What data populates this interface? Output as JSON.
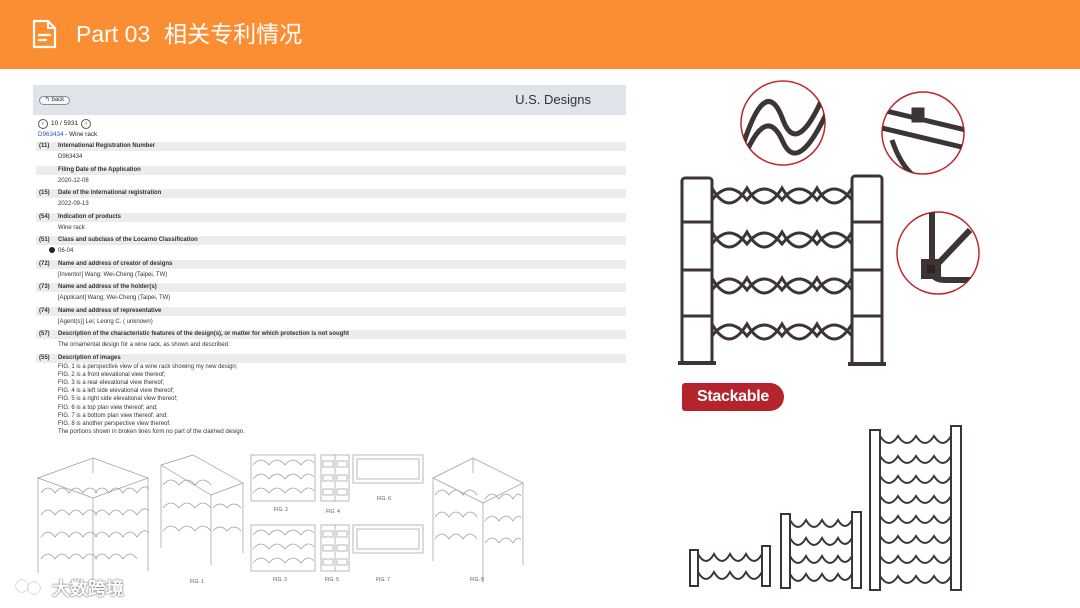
{
  "header": {
    "part": "Part 03",
    "title": "相关专利情况"
  },
  "patent": {
    "back_label": "back",
    "db_title": "U.S. Designs",
    "pager": "10 / 5931",
    "doc_number": "D963434",
    "doc_sep": " - ",
    "doc_name": "Wine rack",
    "fields": [
      {
        "code": "(11)",
        "label": "International Registration Number",
        "value": "D963434"
      },
      {
        "code": "",
        "label": "Filing Date of the Application",
        "value": "2020-12-08"
      },
      {
        "code": "(15)",
        "label": "Date of the international registration",
        "value": "2022-09-13"
      },
      {
        "code": "(54)",
        "label": "Indication of products",
        "value": "Wine rack"
      },
      {
        "code": "(51)",
        "label": "Class and subclass of the Locarno Classification",
        "value": "06-04"
      },
      {
        "code": "(72)",
        "label": "Name and address of creator of designs",
        "value": "[Inventor] Wang; Wei-Cheng (Taipei, TW)"
      },
      {
        "code": "(73)",
        "label": "Name and address of the holder(s)",
        "value": "[Applicant]  Wang; Wei-Cheng (Taipei, TW)"
      },
      {
        "code": "(74)",
        "label": "Name and address of representative",
        "value": "[Agent(s)] Lei; Leong C. ( unknown)"
      },
      {
        "code": "(57)",
        "label": "Description of the characteristic features of the design(s), or matter for which protection is not sought",
        "value": "The ornamental design for a wine rack, as shown and described."
      }
    ],
    "images_field": {
      "code": "(55)",
      "label": "Description of images",
      "lines": [
        "FIG. 1 is a perspective view of a wine rack showing my new design;",
        "FIG. 2 is a front elevational view thereof;",
        "FIG. 3 is a rear elevational view thereof;",
        "FIG. 4 is a left side elevational view thereof;",
        "FIG. 5 is a right side elevational view thereof;",
        "FIG. 6 is a top plan view thereof; and;",
        "FIG. 7 is a bottom plan view thereof; and;",
        "FIG. 8 is another perspective view thereof.",
        "The portions shown in broken lines form no part of the claimed design."
      ]
    },
    "fig_labels": [
      "FIG. 1",
      "FIG. 2",
      "FIG. 3",
      "FIG. 4",
      "FIG. 5",
      "FIG. 6",
      "FIG. 7",
      "FIG. 8"
    ]
  },
  "promo": {
    "stackable_label": "Stackable"
  },
  "watermark": {
    "text": "大数跨境"
  },
  "colors": {
    "header_bg": "#fb8e32",
    "patent_bar": "#dfe3ea",
    "badge_red": "#b3242c",
    "rack_metal": "#3d3533"
  }
}
